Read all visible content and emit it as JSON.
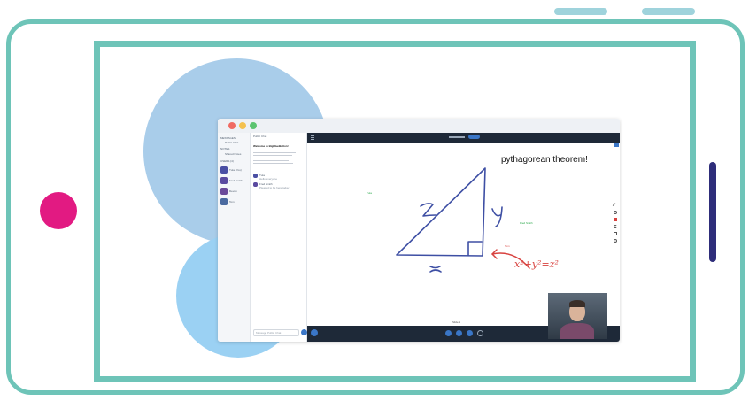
{
  "presentation": {
    "whiteboard_title": "pythagorean theorem!",
    "drawn_labels": {
      "hypotenuse": "z",
      "vertical_side": "y",
      "horizontal_side": "x"
    },
    "equation": "x²+y²=z²",
    "annotation_tags": [
      "Tuta",
      "Fred Smith",
      "Tom"
    ],
    "slide_indicator": "Slide 1"
  },
  "chat": {
    "header": "Public Chat",
    "welcome_title": "Welcome to BigBlueButton!",
    "message_placeholder": "Message Public Chat",
    "messages": [
      {
        "author": "Tuta",
        "text": "Hello everyone"
      },
      {
        "author": "Fred Smith",
        "text": "Pleased to be here today"
      }
    ]
  },
  "sidebar": {
    "messages_heading": "MESSAGES",
    "public_chat_label": "Public Chat",
    "notes_heading": "NOTES",
    "shared_notes_label": "Shared Notes",
    "users_heading": "USERS (4)",
    "users": [
      "Tuta (You)",
      "Fred Smith",
      "Devon",
      "Tom"
    ]
  },
  "colors": {
    "frame": "#6ec4b8",
    "home_button": "#e21a82",
    "side_button": "#2e2d7a",
    "drawing_blue": "#3e4fa4",
    "drawing_red": "#d8423f",
    "toolbar_dark": "#1e2938"
  }
}
